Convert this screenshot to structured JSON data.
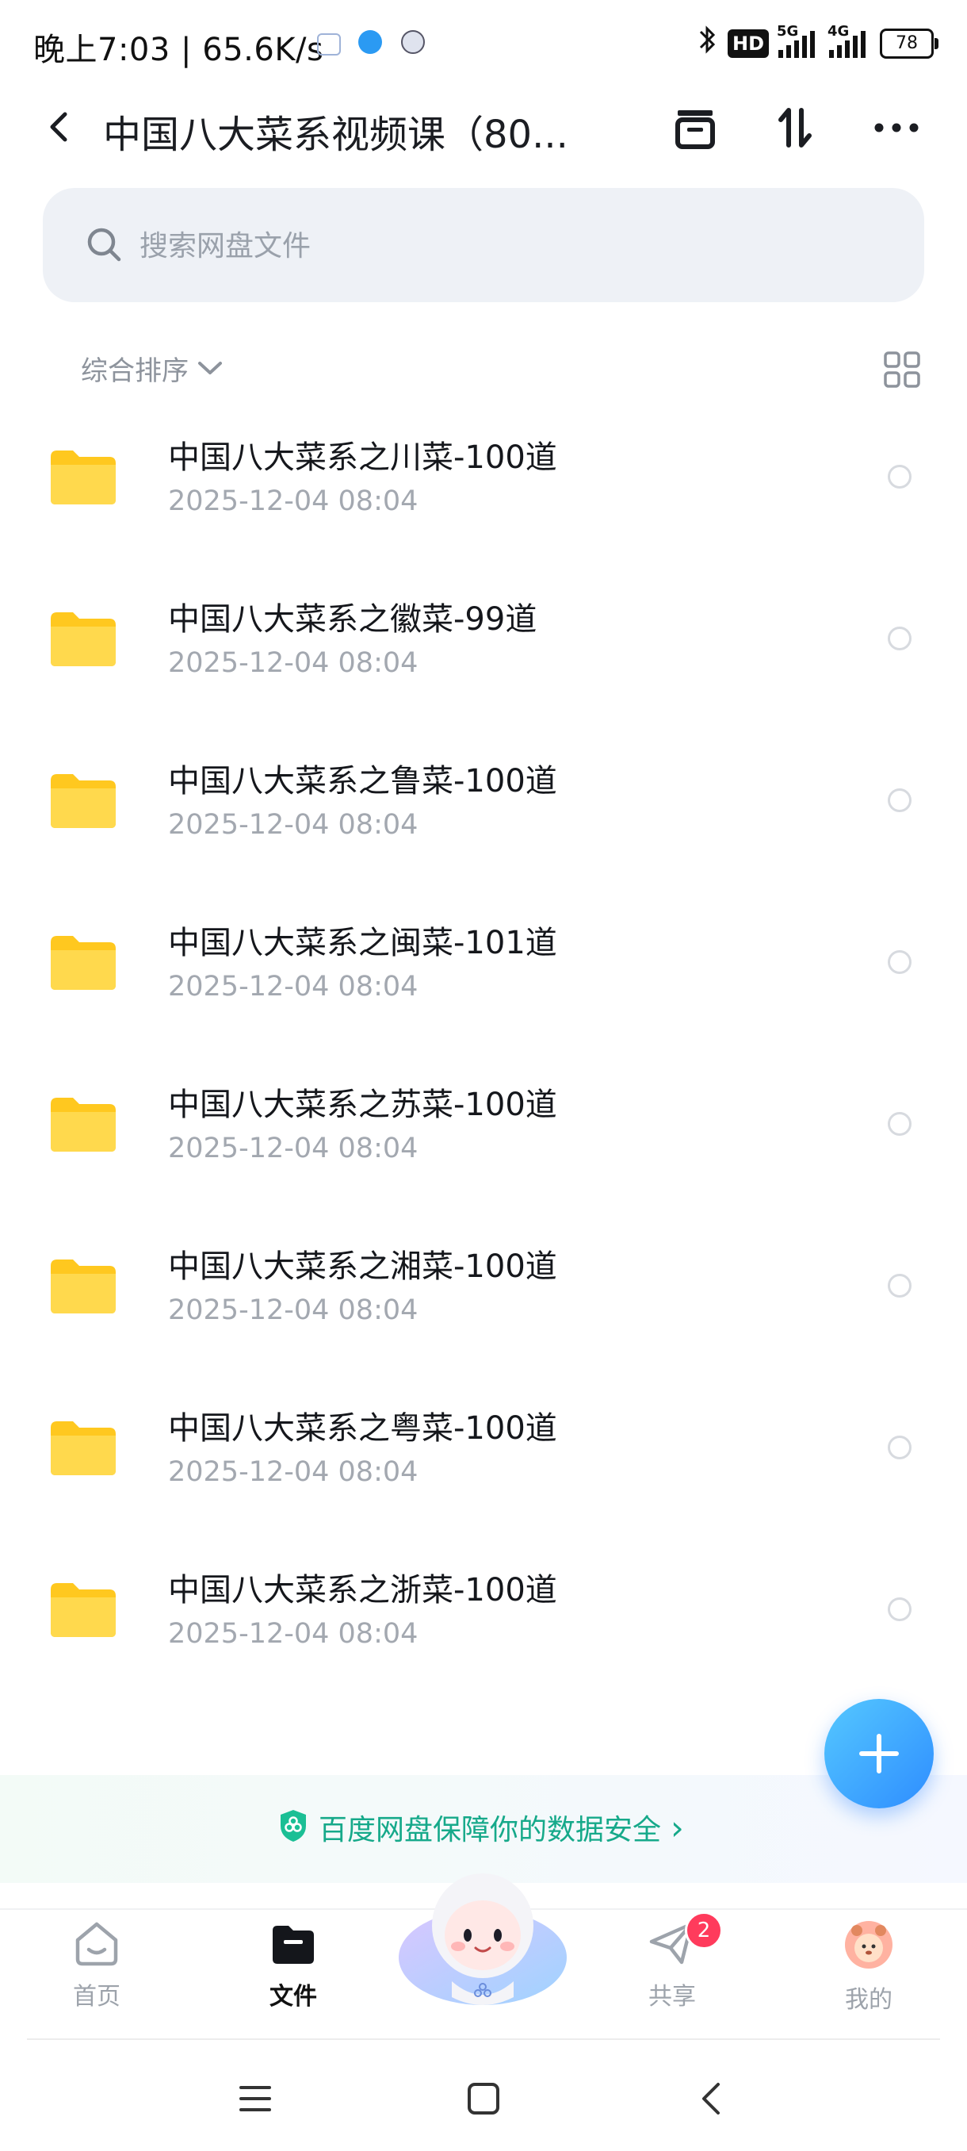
{
  "status_bar": {
    "time": "晚上7:03",
    "separator": "|",
    "speed": "65.6K/s",
    "hd_label": "HD",
    "network_1": "5G",
    "network_2": "4G",
    "battery": "78"
  },
  "header": {
    "title": "中国八大菜系视频课（80...",
    "icons": [
      "back-icon",
      "archive-box-icon",
      "sort-arrows-icon",
      "more-icon"
    ]
  },
  "search": {
    "placeholder": "搜索网盘文件"
  },
  "sort": {
    "label": "综合排序"
  },
  "files": [
    {
      "name": "中国八大菜系之川菜-100道",
      "date": "2025-12-04  08:04"
    },
    {
      "name": "中国八大菜系之徽菜-99道",
      "date": "2025-12-04  08:04"
    },
    {
      "name": "中国八大菜系之鲁菜-100道",
      "date": "2025-12-04  08:04"
    },
    {
      "name": "中国八大菜系之闽菜-101道",
      "date": "2025-12-04  08:04"
    },
    {
      "name": "中国八大菜系之苏菜-100道",
      "date": "2025-12-04  08:04"
    },
    {
      "name": "中国八大菜系之湘菜-100道",
      "date": "2025-12-04  08:04"
    },
    {
      "name": "中国八大菜系之粤菜-100道",
      "date": "2025-12-04  08:04"
    },
    {
      "name": "中国八大菜系之浙菜-100道",
      "date": "2025-12-04  08:04"
    }
  ],
  "banner": {
    "text": "百度网盘保障你的数据安全",
    "chevron": "›"
  },
  "bottom_nav": {
    "home": "首页",
    "files": "文件",
    "share": "共享",
    "share_badge": "2",
    "mine": "我的"
  },
  "colors": {
    "accent_blue": "#2e8dff",
    "folder_yellow": "#ffd33d",
    "security_green": "#16a98a",
    "badge_red": "#ff3b5c"
  }
}
